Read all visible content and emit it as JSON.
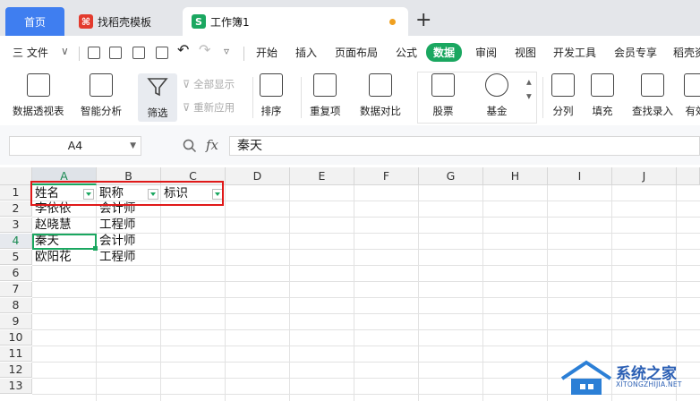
{
  "tabs": {
    "home": "首页",
    "template": "找稻壳模板",
    "workbook": "工作簿1",
    "add": "+"
  },
  "menu": {
    "file": "三 文件",
    "items": [
      "开始",
      "插入",
      "页面布局",
      "公式",
      "数据",
      "审阅",
      "视图",
      "开发工具",
      "会员专享",
      "稻壳资"
    ]
  },
  "ribbon": {
    "pivot": "数据透视表",
    "smart": "智能分析",
    "filter": "筛选",
    "show_all": "全部显示",
    "reapply": "重新应用",
    "sort": "排序",
    "dup": "重复项",
    "compare": "数据对比",
    "stock": "股票",
    "fund": "基金",
    "split": "分列",
    "fill": "填充",
    "lookup": "查找录入",
    "valid": "有效"
  },
  "formula_bar": {
    "cell_ref": "A4",
    "fx": "fx",
    "content": "秦天"
  },
  "sheet": {
    "columns": [
      "A",
      "B",
      "C",
      "D",
      "E",
      "F",
      "G",
      "H",
      "I",
      "J"
    ],
    "rows": [
      "1",
      "2",
      "3",
      "4",
      "5",
      "6",
      "7",
      "8",
      "9",
      "10",
      "11",
      "12",
      "13"
    ],
    "active_col": "A",
    "active_row": "4",
    "cells": {
      "A1": "姓名",
      "B1": "职称",
      "C1": "标识",
      "A2": "李依依",
      "B2": "会计师",
      "A3": "赵晓慧",
      "B3": "工程师",
      "A4": "秦天",
      "B4": "会计师",
      "A5": "欧阳花",
      "B5": "工程师"
    }
  },
  "watermark": {
    "title": "系统之家",
    "sub": "XITONGZHIJIA.NET"
  },
  "colors": {
    "accent": "#1aa760",
    "home_tab": "#3f7ef0",
    "highlight": "#e01919"
  }
}
